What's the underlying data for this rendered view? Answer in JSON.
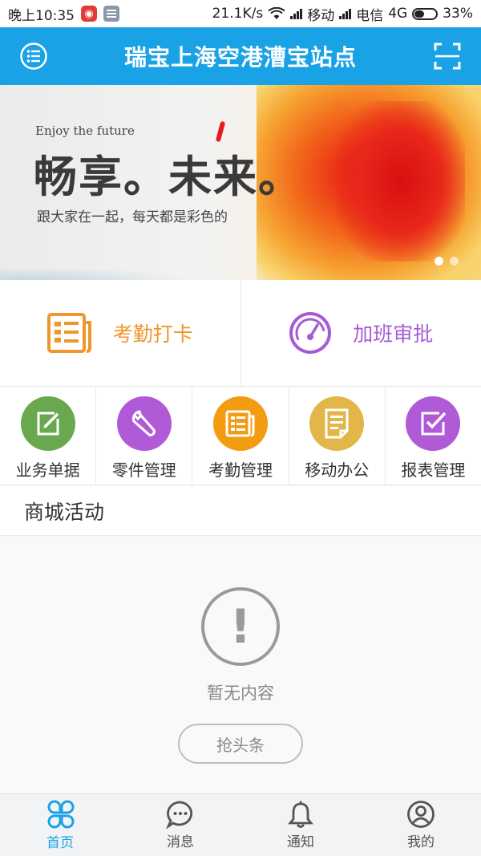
{
  "status_bar": {
    "time": "晚上10:35",
    "speed": "21.1K/s",
    "carrier1": "移动",
    "carrier2": "电信",
    "network": "4G",
    "battery": "33%"
  },
  "header": {
    "title": "瑞宝上海空港漕宝站点",
    "menu_icon": "list-menu-icon",
    "scan_icon": "scan-icon",
    "bg_color": "#1aa2e6"
  },
  "banner": {
    "small_text": "Enjoy the future",
    "big_text": "畅享。未来。",
    "subtitle": "跟大家在一起，每天都是彩色的",
    "slide_count": 2,
    "active_slide": 1
  },
  "quick_actions": [
    {
      "label": "考勤打卡",
      "icon": "attendance-card-icon",
      "color": "#f0962a"
    },
    {
      "label": "加班审批",
      "icon": "gauge-icon",
      "color": "#a55bd6"
    }
  ],
  "grid": [
    {
      "label": "业务单据",
      "icon": "edit-icon",
      "color": "#6aa84f"
    },
    {
      "label": "零件管理",
      "icon": "wrench-icon",
      "color": "#b05ad8"
    },
    {
      "label": "考勤管理",
      "icon": "newspaper-icon",
      "color": "#f39c12"
    },
    {
      "label": "移动办公",
      "icon": "document-icon",
      "color": "#e3b64a"
    },
    {
      "label": "报表管理",
      "icon": "checkbox-icon",
      "color": "#b05ad8"
    }
  ],
  "section": {
    "title": "商城活动",
    "empty_icon": "!",
    "empty_text": "暂无内容",
    "button_label": "抢头条"
  },
  "tabs": [
    {
      "label": "首页",
      "icon": "home-clover-icon",
      "active": true
    },
    {
      "label": "消息",
      "icon": "chat-icon",
      "active": false
    },
    {
      "label": "通知",
      "icon": "bell-icon",
      "active": false
    },
    {
      "label": "我的",
      "icon": "user-icon",
      "active": false
    }
  ],
  "colors": {
    "accent": "#1aa2e6",
    "orange": "#f0962a",
    "purple": "#a55bd6"
  }
}
